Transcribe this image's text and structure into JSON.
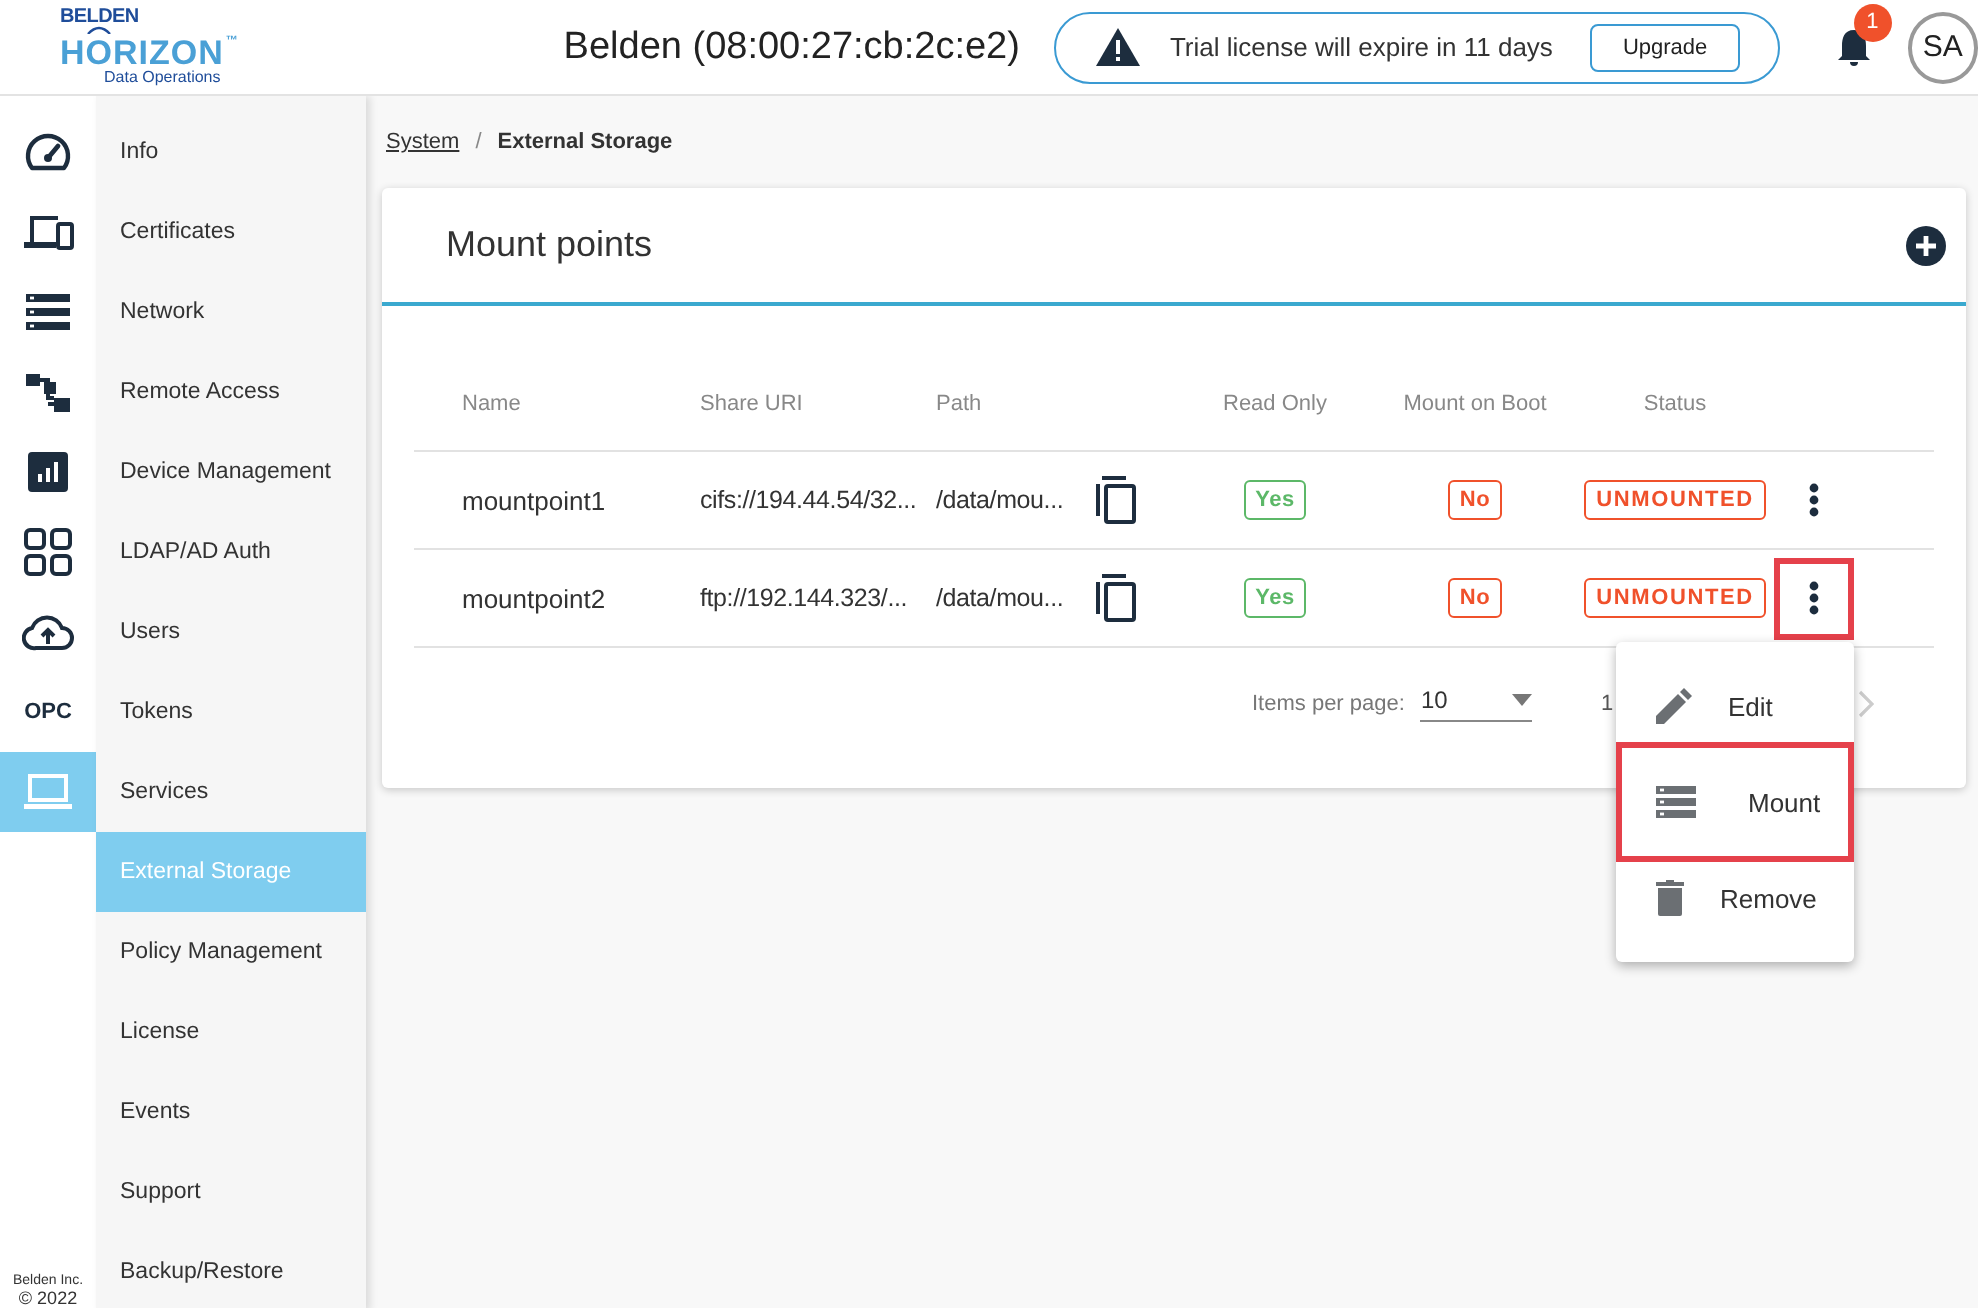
{
  "header": {
    "logo_top": "BELDEN",
    "logo_main": "H",
    "logo_o": "O",
    "logo_rest": "RIZON",
    "logo_tm": "™",
    "logo_sub": "Data Operations",
    "device": "Belden (08:00:27:cb:2c:e2)",
    "trial_notice": "Trial license will expire in 11 days",
    "upgrade_button": "Upgrade",
    "notification_count": "1",
    "avatar": "SA"
  },
  "icon_rail": {
    "items": [
      {
        "kind": "gauge",
        "selected": false
      },
      {
        "kind": "devices",
        "selected": false
      },
      {
        "kind": "list",
        "selected": false
      },
      {
        "kind": "hierarchy",
        "selected": false
      },
      {
        "kind": "chart",
        "selected": false
      },
      {
        "kind": "grid",
        "selected": false
      },
      {
        "kind": "cloud",
        "selected": false
      },
      {
        "kind": "text",
        "label": "OPC",
        "selected": false
      },
      {
        "kind": "laptop",
        "selected": true
      }
    ],
    "footer": [
      "Belden Inc.",
      "© 2022"
    ]
  },
  "nav": {
    "items": [
      {
        "label": "Info",
        "selected": false
      },
      {
        "label": "Certificates",
        "selected": false
      },
      {
        "label": "Network",
        "selected": false
      },
      {
        "label": "Remote Access",
        "selected": false
      },
      {
        "label": "Device Management",
        "selected": false
      },
      {
        "label": "LDAP/AD Auth",
        "selected": false
      },
      {
        "label": "Users",
        "selected": false
      },
      {
        "label": "Tokens",
        "selected": false
      },
      {
        "label": "Services",
        "selected": false
      },
      {
        "label": "External Storage",
        "selected": true
      },
      {
        "label": "Policy Management",
        "selected": false
      },
      {
        "label": "License",
        "selected": false
      },
      {
        "label": "Events",
        "selected": false
      },
      {
        "label": "Support",
        "selected": false
      },
      {
        "label": "Backup/Restore",
        "selected": false
      }
    ]
  },
  "breadcrumb": [
    {
      "label": "System",
      "kind": "link"
    },
    {
      "label": "/",
      "kind": "separator"
    },
    {
      "label": "External Storage",
      "kind": "current"
    }
  ],
  "card": {
    "title": "Mount points",
    "columns": [
      "Name",
      "Share URI",
      "Path",
      "Read Only",
      "Mount on Boot",
      "Status"
    ],
    "rows": [
      {
        "name": "mountpoint1",
        "share_uri": "cifs://194.44.54/32...",
        "path": "/data/mou...",
        "read_only": {
          "label": "Yes",
          "color": "#5cb868"
        },
        "mount_on_boot": {
          "label": "No",
          "color": "#f0512b"
        },
        "status": "UNMOUNTED",
        "highlighted": false
      },
      {
        "name": "mountpoint2",
        "share_uri": "ftp://192.144.323/...",
        "path": "/data/mou...",
        "read_only": {
          "label": "Yes",
          "color": "#5cb868"
        },
        "mount_on_boot": {
          "label": "No",
          "color": "#f0512b"
        },
        "status": "UNMOUNTED",
        "highlighted": true
      }
    ],
    "pagination": {
      "items_per_page_label": "Items per page:",
      "items_per_page": "10",
      "range": "1"
    }
  },
  "menu": {
    "items": [
      {
        "kind": "edit",
        "label": "Edit",
        "highlighted": false
      },
      {
        "kind": "mount",
        "label": "Mount",
        "highlighted": true
      },
      {
        "kind": "delete",
        "label": "Remove",
        "highlighted": false
      }
    ]
  }
}
